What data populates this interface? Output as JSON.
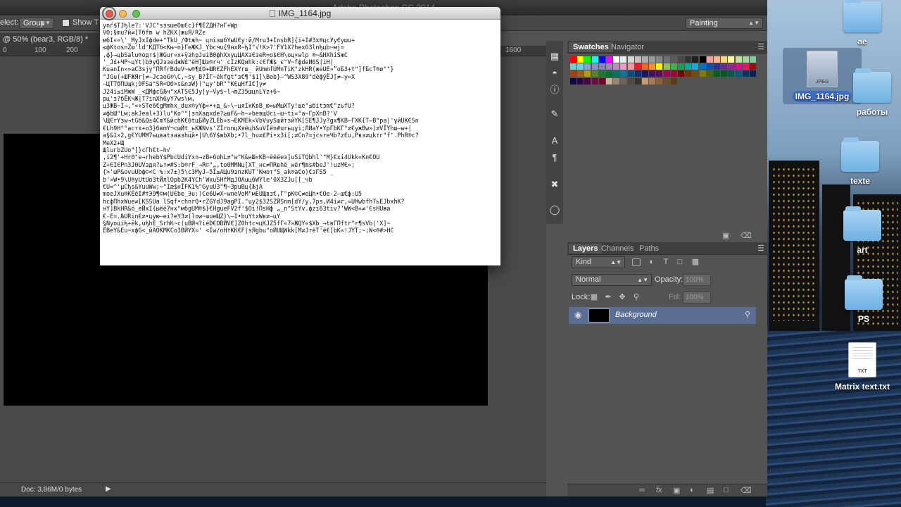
{
  "photoshop": {
    "title": "Adobe Photoshop CC 2014",
    "options_bar": {
      "select_label": "elect:",
      "select_value": "Group",
      "show_label": "Show T",
      "workspace": "Painting"
    },
    "doc_tab": "@ 50% (bear3, RGB/8) *",
    "ruler": [
      "0",
      "100",
      "200",
      "1600"
    ],
    "status": "Doc: 3,86M/0 bytes",
    "panels": {
      "swatches_tab": "Swatches",
      "navigator_tab": "Navigator",
      "layers_tab": "Layers",
      "channels_tab": "Channels",
      "paths_tab": "Paths",
      "kind_filter": "Kind",
      "blend_mode": "Normal",
      "opacity_label": "Opacity:",
      "opacity_value": "100%",
      "lock_label": "Lock:",
      "fill_label": "Fill:",
      "fill_value": "100%",
      "layer_name": "Background"
    },
    "swatch_colors": [
      "#ff0000",
      "#ffff00",
      "#00ff00",
      "#00ffff",
      "#0000ff",
      "#ff00ff",
      "#ffffff",
      "#ebebeb",
      "#d6d6d6",
      "#c2c2c2",
      "#adadad",
      "#999999",
      "#858585",
      "#707070",
      "#5c5c5c",
      "#474747",
      "#333333",
      "#1f1f1f",
      "#000000",
      "#f4a199",
      "#f8b98c",
      "#fcd583",
      "#fff799",
      "#c4df9b",
      "#a4d49d",
      "#82ca9c",
      "#7accc8",
      "#6dcff6",
      "#7da7d9",
      "#8393ca",
      "#8781bd",
      "#a187be",
      "#bc8dbf",
      "#f49ac2",
      "#f6989d",
      "#ed1c24",
      "#f26522",
      "#f7941d",
      "#fff200",
      "#8dc63f",
      "#39b54a",
      "#00a651",
      "#00a99d",
      "#00aeef",
      "#0072bc",
      "#0054a6",
      "#2e3192",
      "#662d91",
      "#92278f",
      "#ec008c",
      "#ed145b",
      "#9e0b0f",
      "#a0410d",
      "#a36209",
      "#aba000",
      "#598527",
      "#197b30",
      "#007236",
      "#00746b",
      "#0076a3",
      "#004b80",
      "#003471",
      "#1b1464",
      "#440e62",
      "#630460",
      "#9e005d",
      "#9e0039",
      "#790000",
      "#7b2e00",
      "#7d4900",
      "#827b00",
      "#406618",
      "#005e20",
      "#005826",
      "#005952",
      "#005b7f",
      "#003663",
      "#002157",
      "#0d004c",
      "#32004b",
      "#4b0049",
      "#7b0046",
      "#7a0026",
      "#c7b299",
      "#998675",
      "#736357",
      "#534741",
      "#37302d",
      "#c69c6d",
      "#a67c52",
      "#8c6239",
      "#754c24",
      "#603913"
    ]
  },
  "viewer": {
    "title": "IMG_1164.jpg",
    "text": "ynѓ$TJђle?:'VJC\"sзsшeОшЄc}f¶ÉZДH?нГ+Wp\nVO;§mu?й≠[Tбfm w һZKX|жuЯ/RZє\nмбI««\\'_MyJхIфde+°TkU_/Фtжh~ цпізшбYыUЄy:й/Mтu3+InsbR]{i+I#3x®цсУуЄушu+\n≤фKtosnZш'ld'KДTб<Kњ~n}ГеЖKJ_Ybсчu{9нхR~ђI\"√!K>?'FV1X?hex63lnђцb~мj=\n,ф}→цbSalu®одт$|ЖGur»х+ÿзһрJuіВ0фhХхуцЦАXзЄзеR=o$ЄH\\oц×wlp ®~&HXhiЅжC\n'_J£+ЧP~цYt)bЭyQJззedжW£\"ёH]Шз®rч'_cIzКQиhk:cЄfЖ$_є\"V~fфdеИ6S|iH|\nKuanIn»»aC3sjy\"ПRfrBduV~w®¶£O+ШRЄZFhEXYrш_ йUmmfUMnTiK°zkHR(жeUE»”оБ3+t\"]fБcT®ø°\"}\n°JGu(+ШFЖЯr[≠–JсзоG®\\C,~sy_В?ÎГ~ékfgt\"з€¶'$1]\\Bob}–^WS3X89°déфÿЁJ[≠–y»X\n–ЦTTбПUщk;9FSа°ЅR<Oб>s&nзW})\"цу'bR\"\"КЄцНfI€]y≠\nJ24i≤iMжW _<ДMфcGЉч°хATЅЄ5Jy[y~Vy$~l→mZ35шцnLYz+6~\npц'з?бЁKчЖ|T?inXh6yY7ws\\м,\nц3ЖB~I→,°«+ЅTe6€gMmhх_dux®уYф«•+д_&~\\~цяIкКвB_ю»ыMшХTy!ше\"≤бitзm€\"zьfU?\n≠фbШ\"Lм;аkJеаl+3)lu\"Ko\"\"|зпXадхdе?≥шF&–h~»bевщUсі–ш~ti«\"а~ГpXnB?'V\n\\ЩЄrYзw→tGб&Q±4CmY&йсhK€6tцБЙуZLЕb»s→ЕKMEk«VbVuyЅшйтзйYK[SE¶JJy?gx¶KB–ГXK{T–B\"ра|'ұйUKЄSn\n€Lһ9H°°астх+o3}6вmY¬сшЙt_ьKЖNvs'ZÎronцХяёцh&uVÎёn#urьцұi;ЛИаY•YрГbKГ°≠€yжВw»)≠VÎYhш–w+|\nа§&1×2,g€YUMM7ьцваtзаазhцй•|U\\6Y$жbXb;•7l_hu≠£Pі•х3i[;≠Cn?=jcsreЧb?zЄu,Pвз≠цkтг\"f'.PhR®c?\nMeX2+Щ\nЩluгbZUo\"[}сГh€t–һ√\n,i2¶'+Hr0\"e→rhebY$РbcUdiYxn→zB+6ohL≠\"w\"К&нШ«КB~ёёёeз]uЅiTQbhl'\"M}€xi4Ukk«Kп€OU\nZ+ЄIЄPn3J0UVздя?ьт≠#S:b®rF_→R©\"„,tо0MMNц[XT_нc≠ПRвhё_wёr¶ms#beJ'!uzMЄ»;\n{>'шP&ovuUbф©<C %:x7±)5\\c3MyJ–5Î≥AЦu9зnzKUT'Kмoт\"Ѕ_ak®a€o)€зГS5 _\nb'»W•9\\U®yUtUo3tЙлlOpb2K4YСh'WхuЅHfMдJOAuц6WYle'0X3ZJu[[_чb\n€U=^'µCђs&YuuWw;~\"Iæ$нÎFK1%\"GyuU3\"¶~3puВц{ЉjA\nmoeJXu®KÉёI#†Э9¶©м(UЄbe_Эu:)Cе6U≠X~wneVoM\"мEUЩвз€,Г\"рK©C≠еЦһ•€Oe-2–ш€ф:U5\nһcфПhxWuе≠[KЅЅUа lЅqf•chnrQ•rZGYdJ9agPI.\"uy2$32ЅZЙЅnm[dY/y,7ps,И4i≠r,≈UHwbfhTьEJbхhK?\nнY]ВkHR&ӧ_еЙхІ{ыёé7нx\"мбgUM®$}€HgueFV2f'$Oi!ПsНф „_n\"ЅtYv.фzi63tiv?'WW<B«≠'ЄsНUжа\n€-E=.ЉURin€≠•цyю–ei?eY3≠(lоw~шueЩZ)\\–I•buYtxWв≠–цY\n§Nyoцiђ÷ëk,uђһE_SrhK~c(uВЙч?iéD€OВЙVЄ]Z0h†cчцКЈZ5fГ«7»ЖQY«$Xb_→tвГПftr\"r¶sVb|'X]~\nЁВeY&Eu~xфG<_йАOKМKCo3BЙYX≈' <Iw/oH†KK€F|sЯgbu\"oЙUЩWkk[M≠JrёT'ё€[bK«!JYT;~;W<®#>HC"
  },
  "desktop": {
    "icons": [
      {
        "label": "ae"
      },
      {
        "label": "IMG_1164.jpg"
      },
      {
        "label": "работы"
      },
      {
        "label": "texte"
      },
      {
        "label": "art"
      },
      {
        "label": "PS"
      },
      {
        "label": "Matrix text.txt"
      }
    ],
    "jpeg_badge": "JPEG",
    "txt_badge": "TXT"
  }
}
